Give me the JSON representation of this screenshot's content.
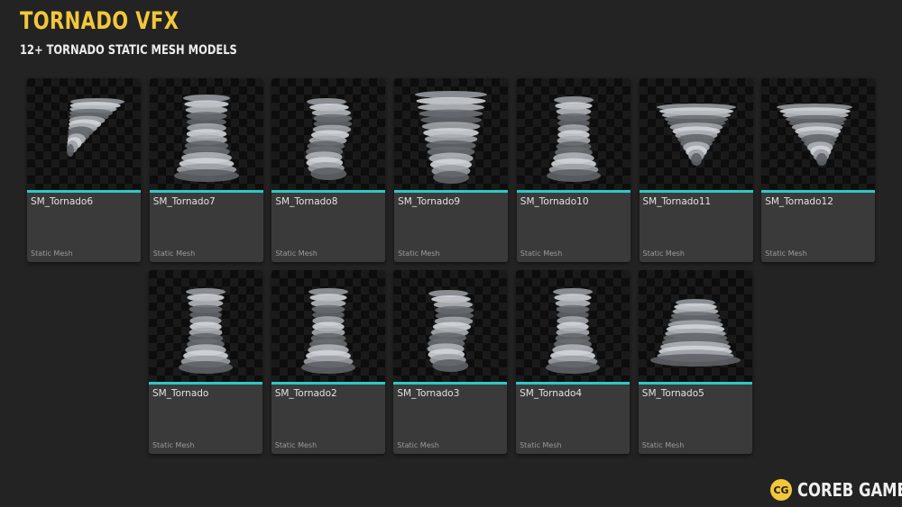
{
  "title": "TORNADO VFX",
  "subtitle": "12+ TORNADO STATIC MESH MODELS",
  "assets": [
    {
      "name": "SM_Tornado6",
      "type": "Static Mesh",
      "shape": "thin-diagonal"
    },
    {
      "name": "SM_Tornado7",
      "type": "Static Mesh",
      "shape": "thick-base"
    },
    {
      "name": "SM_Tornado8",
      "type": "Static Mesh",
      "shape": "twisted"
    },
    {
      "name": "SM_Tornado9",
      "type": "Static Mesh",
      "shape": "funnel"
    },
    {
      "name": "SM_Tornado10",
      "type": "Static Mesh",
      "shape": "column"
    },
    {
      "name": "SM_Tornado11",
      "type": "Static Mesh",
      "shape": "wide-cone"
    },
    {
      "name": "SM_Tornado12",
      "type": "Static Mesh",
      "shape": "wide-cone-tilt"
    },
    {
      "name": "SM_Tornado",
      "type": "Static Mesh",
      "shape": "column"
    },
    {
      "name": "SM_Tornado2",
      "type": "Static Mesh",
      "shape": "column"
    },
    {
      "name": "SM_Tornado3",
      "type": "Static Mesh",
      "shape": "twisted"
    },
    {
      "name": "SM_Tornado4",
      "type": "Static Mesh",
      "shape": "column"
    },
    {
      "name": "SM_Tornado5",
      "type": "Static Mesh",
      "shape": "flat-base"
    }
  ],
  "brand": {
    "badge": "CG",
    "name": "COREB GAMES"
  },
  "colors": {
    "title": "#f2c73a",
    "accent": "#2ec8c8",
    "card": "#3a3a3a",
    "background": "#232323"
  }
}
